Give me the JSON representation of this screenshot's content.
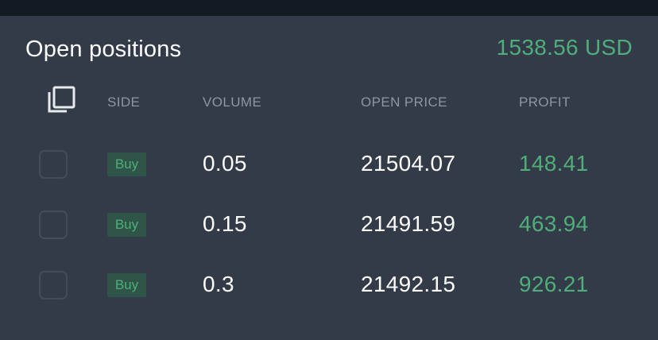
{
  "header": {
    "title": "Open positions",
    "total": "1538.56 USD"
  },
  "columns": {
    "side": "SIDE",
    "volume": "VOLUME",
    "open_price": "OPEN PRICE",
    "profit": "PROFIT"
  },
  "positions": [
    {
      "side": "Buy",
      "volume": "0.05",
      "open_price": "21504.07",
      "profit": "148.41"
    },
    {
      "side": "Buy",
      "volume": "0.15",
      "open_price": "21491.59",
      "profit": "463.94"
    },
    {
      "side": "Buy",
      "volume": "0.3",
      "open_price": "21492.15",
      "profit": "926.21"
    }
  ],
  "icons": {
    "header_action": "copy-icon",
    "row_select": "checkbox"
  },
  "colors": {
    "background": "#333a48",
    "top_bar": "#141a24",
    "profit_green": "#4fae7a",
    "badge_background": "#2e5548",
    "column_header": "#8f96a3"
  }
}
